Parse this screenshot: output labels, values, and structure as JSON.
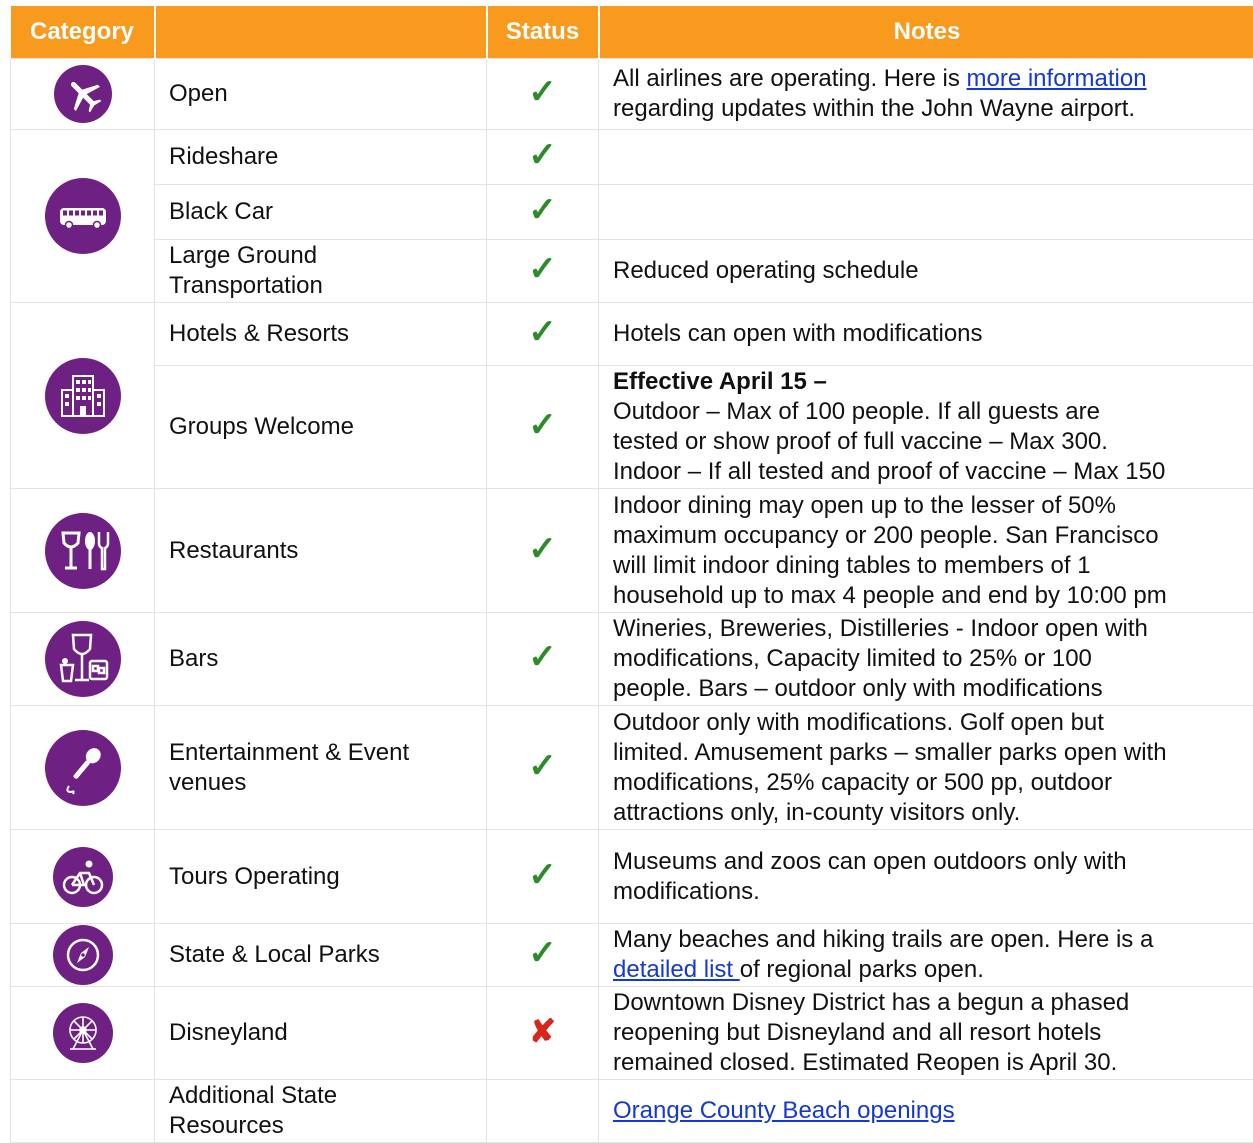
{
  "header": {
    "category": "Category",
    "blank": "",
    "status": "Status",
    "notes": "Notes"
  },
  "colors": {
    "header_bg": "#f79a1e",
    "icon_bg": "#6e2183",
    "check": "#2e8b2a",
    "cross": "#d8261b",
    "link": "#1438d6"
  },
  "rows": [
    {
      "name": "Open",
      "status": "✓",
      "icon": "airplane-icon",
      "notes_a": "All airlines are operating. Here is ",
      "link": "more information",
      "notes_b": "regarding updates within the John Wayne airport."
    },
    {
      "name": "Rideshare",
      "status": "✓",
      "icon": "bus-icon",
      "notes": ""
    },
    {
      "name": "Black Car",
      "status": "✓",
      "notes": ""
    },
    {
      "name_l1": "Large Ground",
      "name_l2": "Transportation",
      "status": "✓",
      "notes": "Reduced operating schedule"
    },
    {
      "name": "Hotels & Resorts",
      "status": "✓",
      "icon": "hotel-building-icon",
      "notes": "Hotels can open with modifications"
    },
    {
      "name": "Groups Welcome",
      "status": "✓",
      "notes_bold": "Effective April 15 –",
      "notes_l1": "Outdoor – Max of 100 people.  If all guests are",
      "notes_l2": "tested or show proof of full vaccine – Max 300.",
      "notes_l3": "Indoor – If all tested and proof of vaccine – Max 150"
    },
    {
      "name": "Restaurants",
      "status": "✓",
      "icon": "wine-fork-knife-icon",
      "notes_l1": "Indoor dining may open up to the lesser of 50%",
      "notes_l2": "maximum occupancy or 200 people.  San Francisco",
      "notes_l3": "will limit indoor dining tables to members of 1",
      "notes_l4": "household up to max 4 people and end by 10:00 pm"
    },
    {
      "name": "Bars",
      "status": "✓",
      "icon": "drinks-icon",
      "notes_l1": "Wineries, Breweries, Distilleries - Indoor open with",
      "notes_l2": "modifications, Capacity limited to 25% or 100",
      "notes_l3": "people. Bars – outdoor only with modifications"
    },
    {
      "name_l1": "Entertainment & Event",
      "name_l2": "venues",
      "status": "✓",
      "icon": "microphone-icon",
      "notes_l1": "Outdoor only with modifications.  Golf open but",
      "notes_l2": "limited. Amusement parks – smaller parks open with",
      "notes_l3": "modifications, 25% capacity or 500 pp, outdoor",
      "notes_l4": "attractions only, in-county visitors only."
    },
    {
      "name": "Tours Operating",
      "status": "✓",
      "icon": "bicycle-icon",
      "notes_l1": "Museums and zoos can open outdoors only with",
      "notes_l2": "modifications."
    },
    {
      "name": "State & Local Parks",
      "status": "✓",
      "icon": "compass-icon",
      "notes_a": "Many beaches and hiking trails are open. Here is a",
      "link": "detailed list ",
      "notes_b": " of regional parks open."
    },
    {
      "name": "Disneyland",
      "status": "✘",
      "icon": "ferris-wheel-icon",
      "notes_l1": "Downtown Disney District has a begun a phased",
      "notes_l2": "reopening but Disneyland and all resort hotels",
      "notes_l3": "remained closed.  Estimated Reopen is April 30."
    },
    {
      "name_l1": "Additional State",
      "name_l2": "Resources",
      "status": "",
      "link": "Orange County Beach openings"
    }
  ]
}
